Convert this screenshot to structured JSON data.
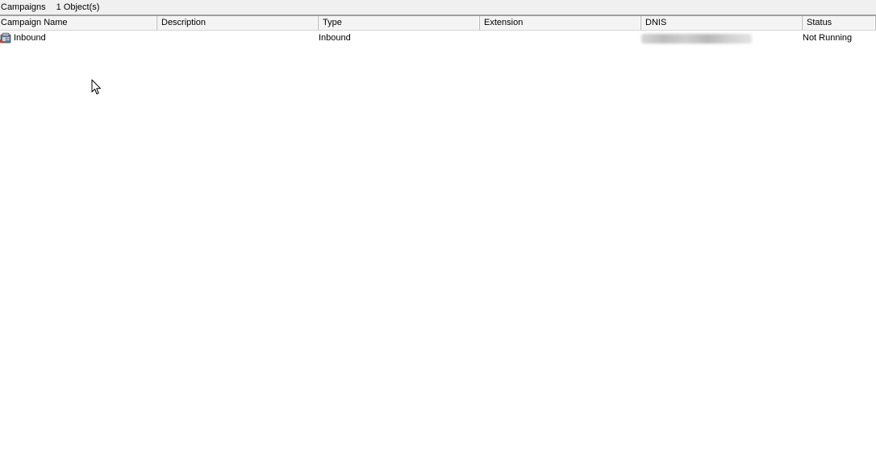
{
  "title_bar": {
    "section": "Campaigns",
    "object_count": "1 Object(s)"
  },
  "table": {
    "columns": [
      {
        "key": "campaign_name",
        "label": "Campaign Name"
      },
      {
        "key": "description",
        "label": "Description"
      },
      {
        "key": "type",
        "label": "Type"
      },
      {
        "key": "extension",
        "label": "Extension"
      },
      {
        "key": "dnis",
        "label": "DNIS"
      },
      {
        "key": "status",
        "label": "Status"
      }
    ],
    "rows": [
      {
        "icon": "campaign-phone-icon",
        "campaign_name": "Inbound",
        "description": "",
        "type": "Inbound",
        "extension": "",
        "dnis": "",
        "dnis_redacted": true,
        "status": "Not Running"
      }
    ]
  },
  "colors": {
    "background": "#ffffff",
    "header_background": "#f4f4f4",
    "title_bar_background": "#f0f0f0",
    "header_rule": "#a0a0a0"
  },
  "cursor": "arrow-cursor-icon"
}
